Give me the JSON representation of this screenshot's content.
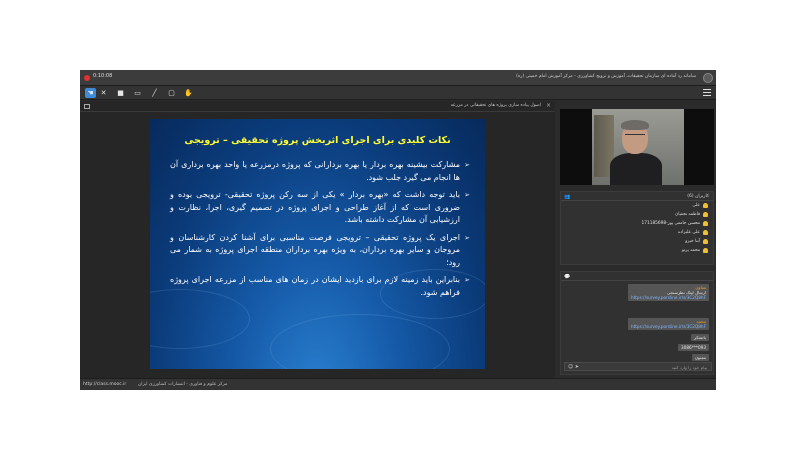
{
  "window": {
    "time": "0:10:08",
    "title": "سامانه رد آماده ای سازمان تحقیقات، آموزش و ترویج کشاورزی - مرکز آموزش امام خمینی (ره)"
  },
  "presentation": {
    "header_title": "اصول پیاده سازی پروژه های تحقیقاتی در مزرعه",
    "slide": {
      "title": "نکات کلیدی برای اجرای اثربخش پروژه تحقیقی – ترویجی",
      "bullets": [
        "مشارکت بیشینه بهره بردار یا بهره بردارانی که پروژه درمزرعه یا واحد بهره برداری آن ها انجام می گیرد جلب شود.",
        "باید توجه داشت که «بهره بردار » یکی از سه رکن پروژه تحقیقی- ترویجی بوده و ضروری است که از آغاز طراحی و اجرای پروژه در تصمیم گیری، اجرا، نظارت و ارزشیابی آن مشارکت داشته باشد.",
        "اجرای یک پروژه تحقیقی – ترویجی فرصت مناسبی برای آشنا کردن کارشناسان و مروجان و سایر بهره برداران، به ویژه بهره برداران منطقه اجرای پروژه به شمار می رود؛",
        "بنابراین باید زمینه لازم برای بازدید ایشان در زمان های مناسب از مزرعه اجرای پروژه فراهم شود."
      ]
    }
  },
  "users_panel": {
    "header": "کاربران (6)",
    "items": [
      "علی",
      "فاطمه نجفیان",
      "محسن جامعی پور-171185698",
      "علی علیزاده",
      "آتنا خیزو",
      "محمد پرتو"
    ]
  },
  "chat_panel": {
    "messages": [
      {
        "sender": "معاون",
        "text": "ارسال لینک نظرسنجی",
        "link": "https://survey.porsline.ir/s/3C2Q8hF"
      },
      {
        "sender": "",
        "text": "",
        "link": ""
      },
      {
        "sender": "محمد",
        "text": "",
        "link": "https://survey.porsline.ir/s/3C2Q8hF"
      },
      {
        "sender": "",
        "text": "باتشکر",
        "link": ""
      },
      {
        "sender": "",
        "text": "093***3086",
        "link": ""
      },
      {
        "sender": "",
        "text": "ممنون",
        "link": ""
      }
    ],
    "input_placeholder": "پیام خود را وارد کنید"
  },
  "statusbar": {
    "url": "http://class.mooc.ir",
    "org": "مرکز علوم و فناوری - انتشارات کشاورزی ایران"
  },
  "icons": {
    "toolbar": [
      "pointer-icon",
      "tools-icon",
      "camera-icon",
      "screen-icon",
      "pen-icon",
      "whiteboard-icon",
      "hand-icon"
    ]
  }
}
